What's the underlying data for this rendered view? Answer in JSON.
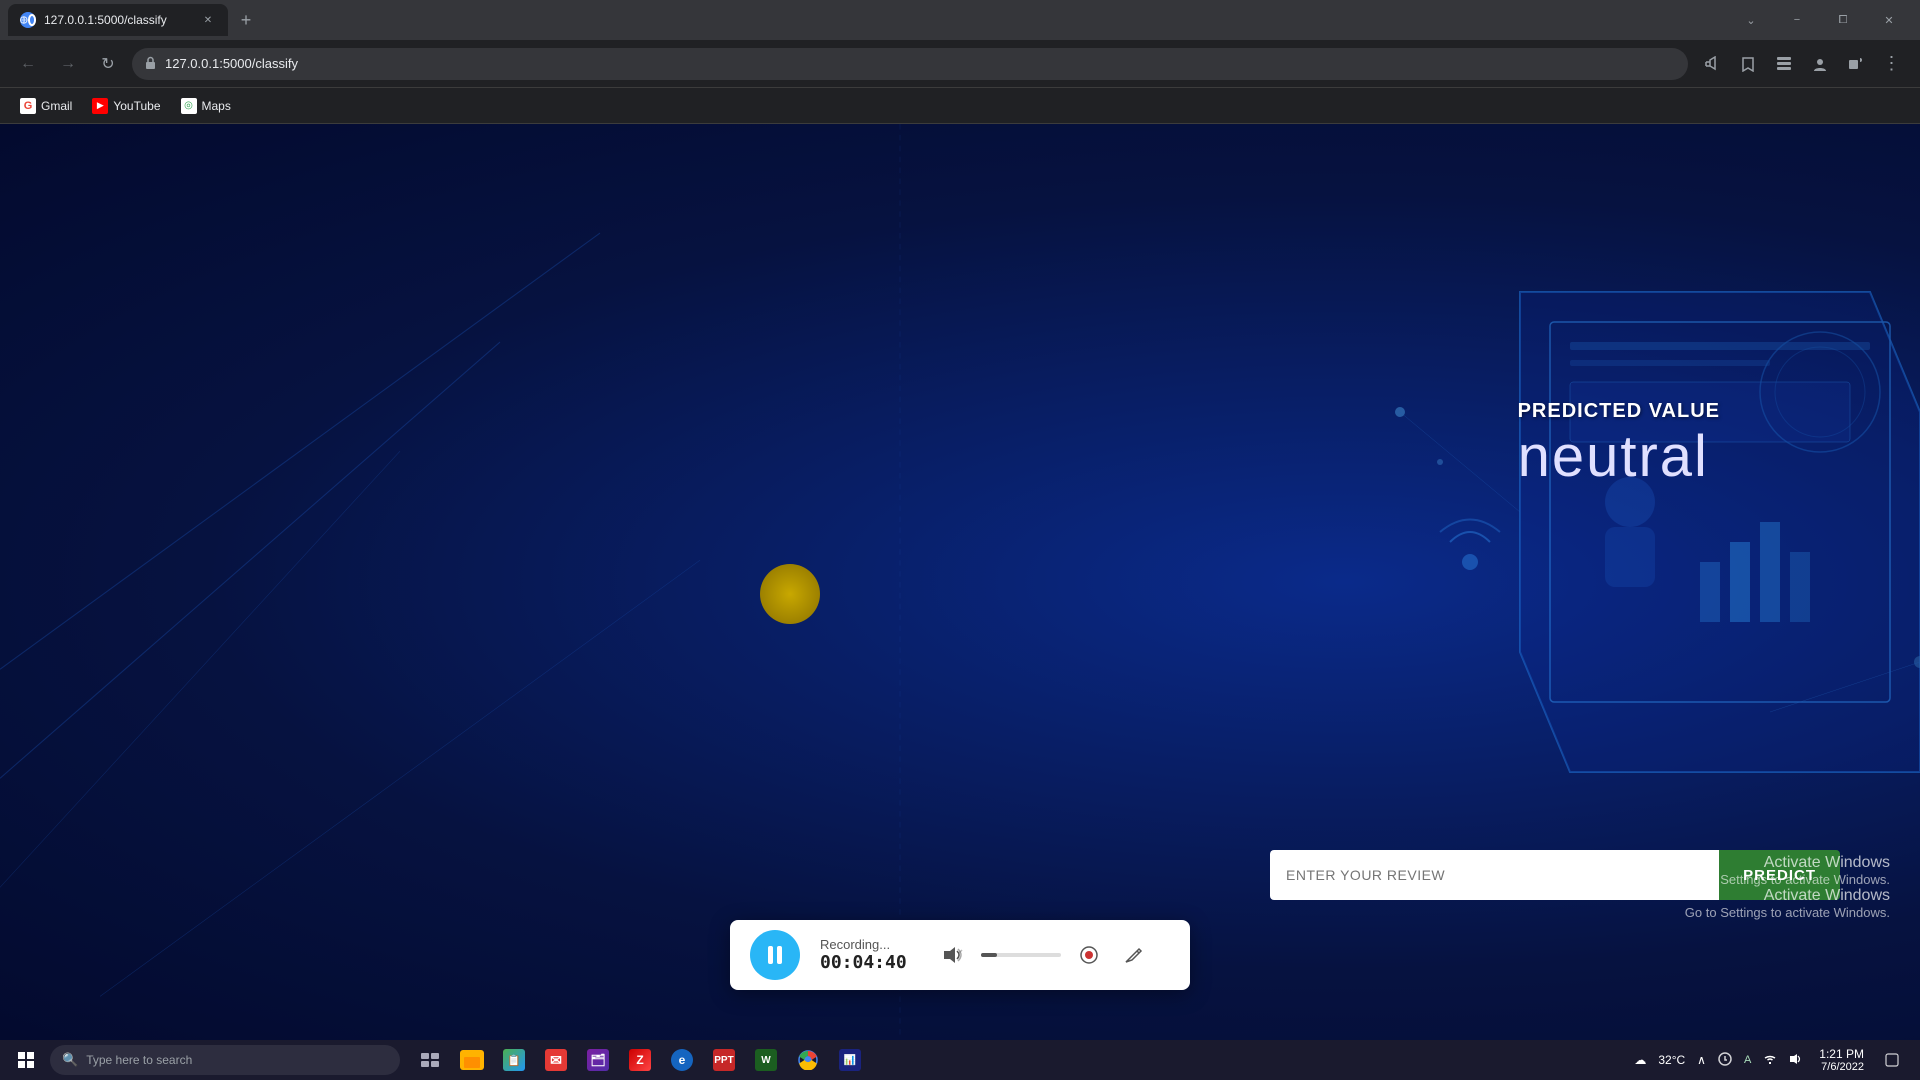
{
  "browser": {
    "tab": {
      "title": "127.0.0.1:5000/classify",
      "favicon": "globe"
    },
    "address": "127.0.0.1:5000/classify",
    "bookmarks": [
      {
        "label": "Gmail",
        "favicon_type": "gmail"
      },
      {
        "label": "YouTube",
        "favicon_type": "youtube"
      },
      {
        "label": "Maps",
        "favicon_type": "maps"
      }
    ],
    "window_controls": {
      "minimize": "−",
      "maximize": "⧠",
      "close": "✕",
      "restore": "⌄"
    }
  },
  "page": {
    "predicted_label": "PREDICTED VALUE",
    "predicted_value": "neutral",
    "review_placeholder": "ENTER YOUR REVIEW",
    "predict_button": "PREDICT",
    "activate_title": "Activate Windows",
    "activate_sub1": "Go to Settings to activate Windows.",
    "activate_sub2": "Activate Windows",
    "activate_sub3": "Go to Settings to activate Windows."
  },
  "recording": {
    "status": "Recording...",
    "timer": "00:04:40",
    "pause_label": "pause"
  },
  "taskbar": {
    "search_placeholder": "Type here to search",
    "clock_time": "1:21 PM",
    "clock_date": "7/6/2022",
    "temp": "32°C"
  }
}
